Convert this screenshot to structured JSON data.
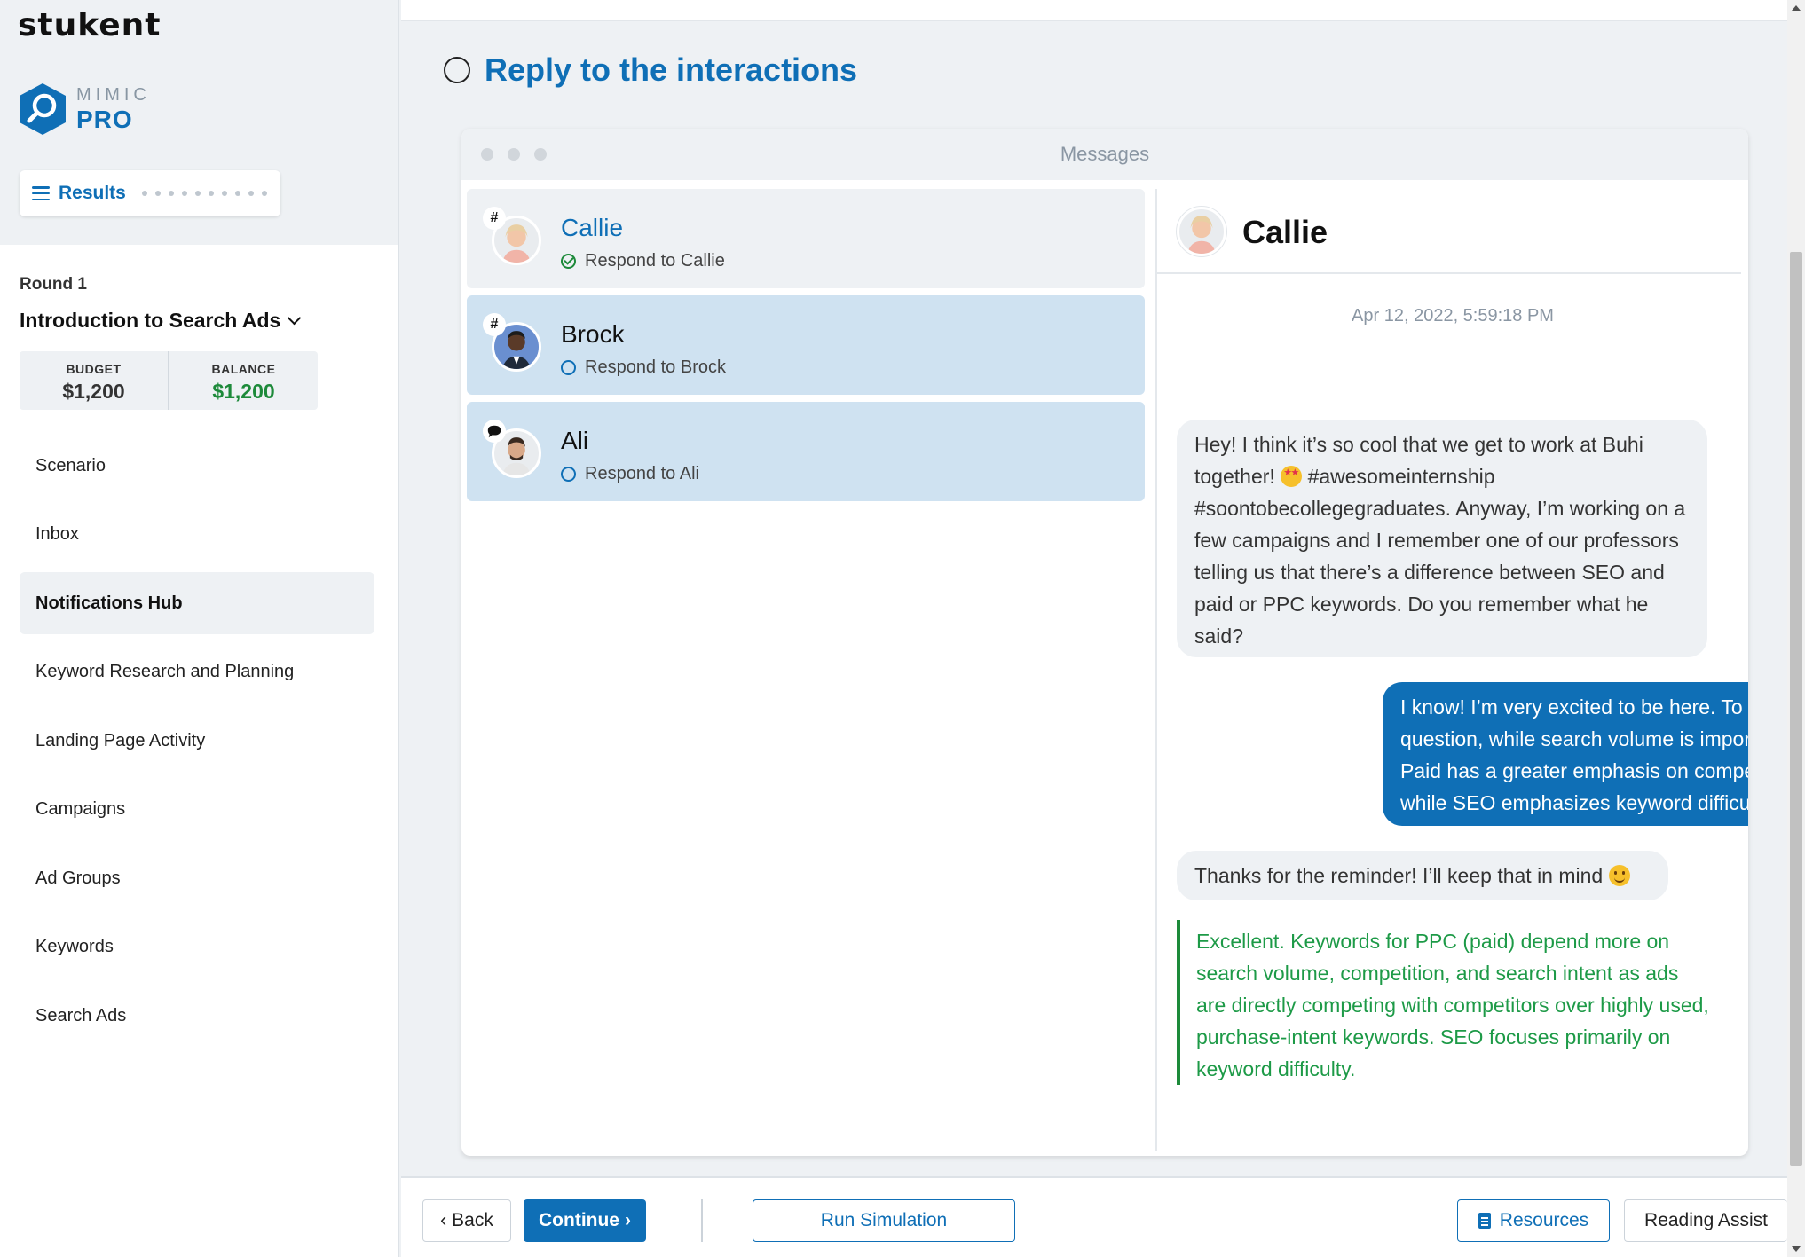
{
  "brand": {
    "company": "stukent",
    "product_small": "MIMIC",
    "product_big": "PRO"
  },
  "results_button": {
    "label": "Results"
  },
  "round": {
    "label": "Round 1",
    "title": "Introduction to Search Ads",
    "budget_label": "BUDGET",
    "budget_value": "$1,200",
    "balance_label": "BALANCE",
    "balance_value": "$1,200"
  },
  "nav": {
    "items": [
      {
        "label": "Scenario"
      },
      {
        "label": "Inbox"
      },
      {
        "label": "Notifications Hub",
        "active": true
      },
      {
        "label": "Keyword Research and Planning"
      },
      {
        "label": "Landing Page Activity"
      },
      {
        "label": "Campaigns"
      },
      {
        "label": "Ad Groups"
      },
      {
        "label": "Keywords"
      },
      {
        "label": "Search Ads"
      }
    ]
  },
  "task": {
    "title": "Reply to the interactions"
  },
  "messages": {
    "window_title": "Messages",
    "threads": [
      {
        "name": "Callie",
        "status": "Respond to Callie",
        "done": true,
        "badge": "slack-icon"
      },
      {
        "name": "Brock",
        "status": "Respond to Brock",
        "done": false,
        "badge": "slack-icon"
      },
      {
        "name": "Ali",
        "status": "Respond to Ali",
        "done": false,
        "badge": "speech-bubble-icon"
      }
    ],
    "conversation": {
      "contact_name": "Callie",
      "timestamp": "Apr 12, 2022, 5:59:18 PM",
      "message1_part1": "Hey! I think it’s so cool that we get to work at Buhi together! ",
      "message1_part2": " #awesomeinternship #soontobecollegegraduates. Anyway, I’m working on a few campaigns and I remember one of our professors telling us that there’s a difference between SEO and paid or PPC keywords. Do you remember what he said?",
      "message2": "I know! I’m very excited to be here. To answer your question, while search volume is important to both, Paid has a greater emphasis on competition and intent while SEO emphasizes keyword difficulty.",
      "message3": "Thanks for the reminder! I’ll keep that in mind ",
      "feedback": "Excellent. Keywords for PPC (paid) depend more on search volume, competition, and search intent as ads are directly competing with competitors over highly used, purchase-intent keywords. SEO focuses primarily on keyword difficulty."
    }
  },
  "footer": {
    "back": "Back",
    "continue": "Continue",
    "run_simulation": "Run Simulation",
    "resources": "Resources",
    "reading_assist": "Reading Assist"
  },
  "colors": {
    "brand_blue": "#0f6fb6",
    "success_green": "#1d8a3a",
    "selected_thread_bg": "#cfe2f1"
  }
}
